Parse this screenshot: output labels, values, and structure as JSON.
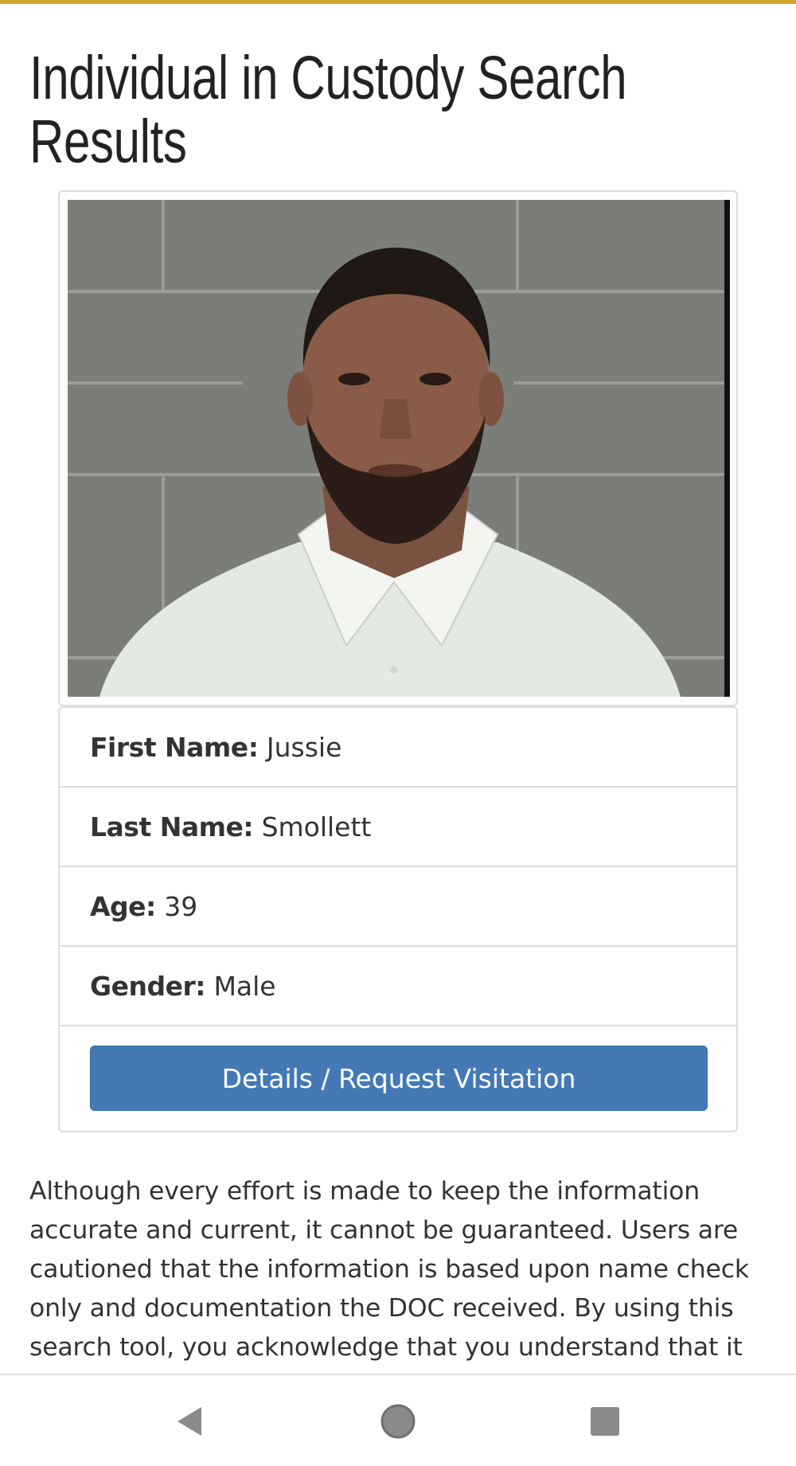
{
  "colors": {
    "accent": "#d4a52c",
    "button_bg": "#4479b5",
    "nav_icon": "#8a8a8a"
  },
  "page": {
    "title": "Individual in Custody Search Results"
  },
  "photo": {
    "description_icon": "mugshot-photo"
  },
  "inmate": {
    "first_name_label": "First Name:",
    "first_name": "Jussie",
    "last_name_label": "Last Name:",
    "last_name": "Smollett",
    "age_label": "Age:",
    "age": "39",
    "gender_label": "Gender:",
    "gender": "Male"
  },
  "actions": {
    "details_label": "Details / Request Visitation"
  },
  "disclaimer": {
    "text": "Although every effort is made to keep the information accurate and current, it cannot be guaranteed. Users are cautioned that the information is based upon name check only and documentation the DOC received. By using this search tool, you acknowledge that you understand that it"
  },
  "nav": {
    "back_icon": "back-triangle-icon",
    "home_icon": "home-circle-icon",
    "recents_icon": "recents-square-icon"
  }
}
